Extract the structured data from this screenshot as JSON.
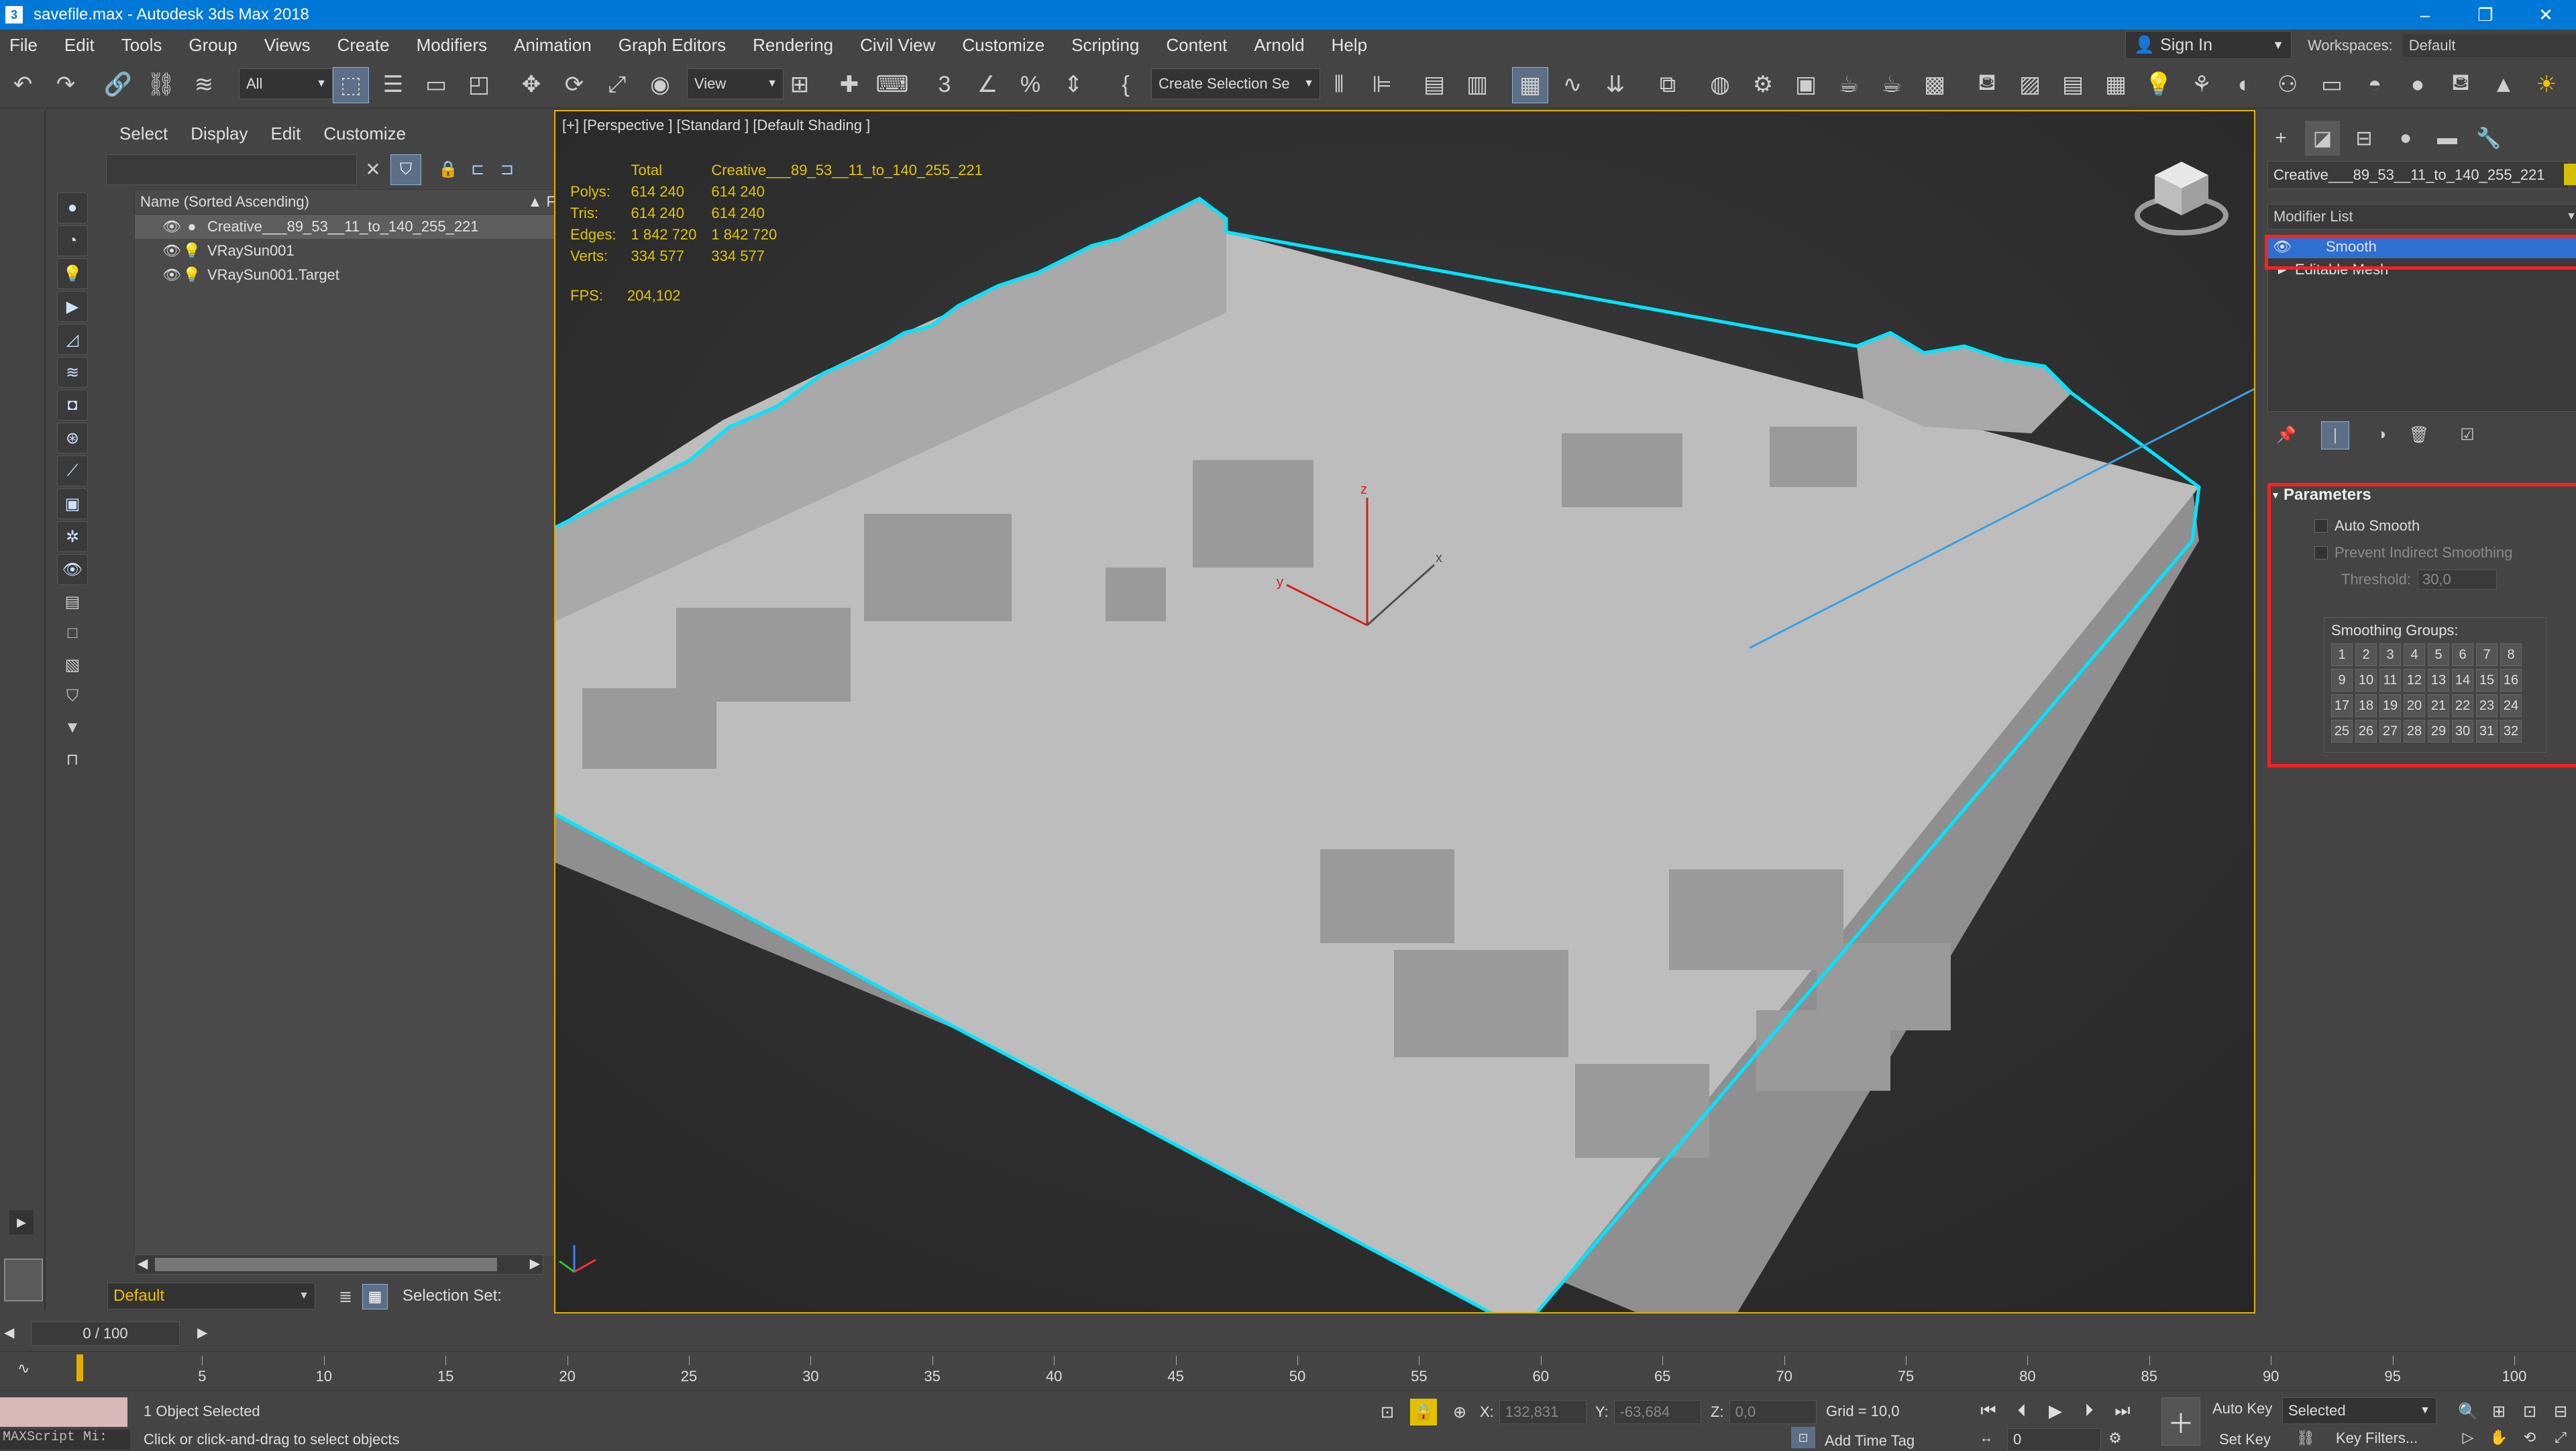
{
  "window": {
    "title": "savefile.max - Autodesk 3ds Max 2018",
    "minimize": "–",
    "maximize": "❐",
    "close": "✕"
  },
  "menu": [
    "File",
    "Edit",
    "Tools",
    "Group",
    "Views",
    "Create",
    "Modifiers",
    "Animation",
    "Graph Editors",
    "Rendering",
    "Civil View",
    "Customize",
    "Scripting",
    "Content",
    "Arnold",
    "Help"
  ],
  "account": {
    "sign_in": "Sign In"
  },
  "workspaces": {
    "label": "Workspaces:",
    "value": "Default"
  },
  "toolbar": {
    "filter_value": "All",
    "refcoord_value": "View",
    "selection_set_placeholder": "Create Selection Se"
  },
  "explorer": {
    "tabs": [
      "Select",
      "Display",
      "Edit",
      "Customize"
    ],
    "header_name": "Name (Sorted Ascending)",
    "header_frozen": "▲ Frozen",
    "rows": [
      {
        "name": "Creative___89_53__11_to_140_255_221",
        "selected": true
      },
      {
        "name": "VRaySun001",
        "selected": false
      },
      {
        "name": "VRaySun001.Target",
        "selected": false
      }
    ],
    "layer": "Default",
    "selection_set_label": "Selection Set:"
  },
  "viewport": {
    "label": "[+] [Perspective ] [Standard ] [Default Shading ]",
    "stats": {
      "col_total": "Total",
      "col_object": "Creative___89_53__11_to_140_255_221",
      "rows": [
        {
          "label": "Polys:",
          "total": "614 240",
          "object": "614 240"
        },
        {
          "label": "Tris:",
          "total": "614 240",
          "object": "614 240"
        },
        {
          "label": "Edges:",
          "total": "1 842 720",
          "object": "1 842 720"
        },
        {
          "label": "Verts:",
          "total": "334 577",
          "object": "334 577"
        }
      ]
    },
    "fps_label": "FPS:",
    "fps_value": "204,102",
    "gizmo": {
      "x": "x",
      "y": "y",
      "z": "z"
    }
  },
  "command_panel": {
    "object_name": "Creative___89_53__11_to_140_255_221",
    "modifier_list": "Modifier List",
    "stack": [
      {
        "name": "Smooth",
        "selected": true
      },
      {
        "name": "Editable Mesh",
        "selected": false
      }
    ],
    "parameters": {
      "title": "Parameters",
      "auto_smooth": "Auto Smooth",
      "prevent_indirect": "Prevent Indirect Smoothing",
      "threshold_label": "Threshold:",
      "threshold_value": "30,0",
      "smoothing_groups_label": "Smoothing Groups:",
      "groups": [
        "1",
        "2",
        "3",
        "4",
        "5",
        "6",
        "7",
        "8",
        "9",
        "10",
        "11",
        "12",
        "13",
        "14",
        "15",
        "16",
        "17",
        "18",
        "19",
        "20",
        "21",
        "22",
        "23",
        "24",
        "25",
        "26",
        "27",
        "28",
        "29",
        "30",
        "31",
        "32"
      ]
    }
  },
  "timeline": {
    "frame_display": "0 / 100",
    "ticks": [
      "5",
      "10",
      "15",
      "20",
      "25",
      "30",
      "35",
      "40",
      "45",
      "50",
      "55",
      "60",
      "65",
      "70",
      "75",
      "80",
      "85",
      "90",
      "95",
      "100"
    ]
  },
  "status": {
    "maxscript": "MAXScript Mi:",
    "objects_selected": "1 Object Selected",
    "prompt": "Click or click-and-drag to select objects",
    "x_label": "X:",
    "x_value": "132,831",
    "y_label": "Y:",
    "y_value": "-63,684",
    "z_label": "Z:",
    "z_value": "0,0",
    "grid": "Grid = 10,0",
    "add_time_tag": "Add Time Tag",
    "auto_key": "Auto Key",
    "selected_dd": "Selected",
    "set_key": "Set Key",
    "key_filters": "Key Filters...",
    "frame": "0"
  },
  "colors": {
    "title_bar": "#0078d7",
    "selection_outline": "#00e5ff",
    "highlight_box": "#ff2020",
    "stats_text": "#e0c500"
  }
}
